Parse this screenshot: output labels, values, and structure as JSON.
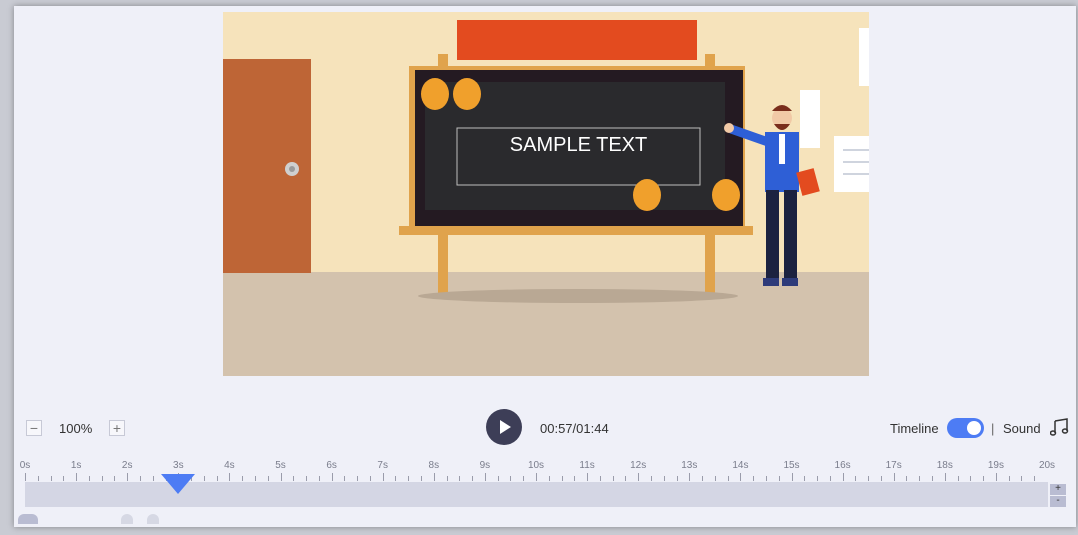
{
  "canvas": {
    "sample_text": "SAMPLE TEXT"
  },
  "zoom": {
    "minus": "−",
    "level": "100%",
    "plus": "+"
  },
  "playback": {
    "time": "00:57/01:44"
  },
  "options": {
    "timeline_label": "Timeline",
    "timeline_on": true,
    "separator": "|",
    "sound_label": "Sound"
  },
  "ruler": {
    "labels": [
      "0s",
      "1s",
      "2s",
      "3s",
      "4s",
      "5s",
      "6s",
      "7s",
      "8s",
      "9s",
      "10s",
      "11s",
      "12s",
      "13s",
      "14s",
      "15s",
      "16s",
      "17s",
      "18s",
      "19s",
      "20s"
    ],
    "playhead_seconds": 3
  },
  "track": {
    "zoom_in": "+",
    "zoom_out": "-"
  },
  "colors": {
    "accent": "#4d7cf4",
    "play_button": "#3d3e57",
    "banner": "#e34b1f",
    "door": "#be6536"
  }
}
